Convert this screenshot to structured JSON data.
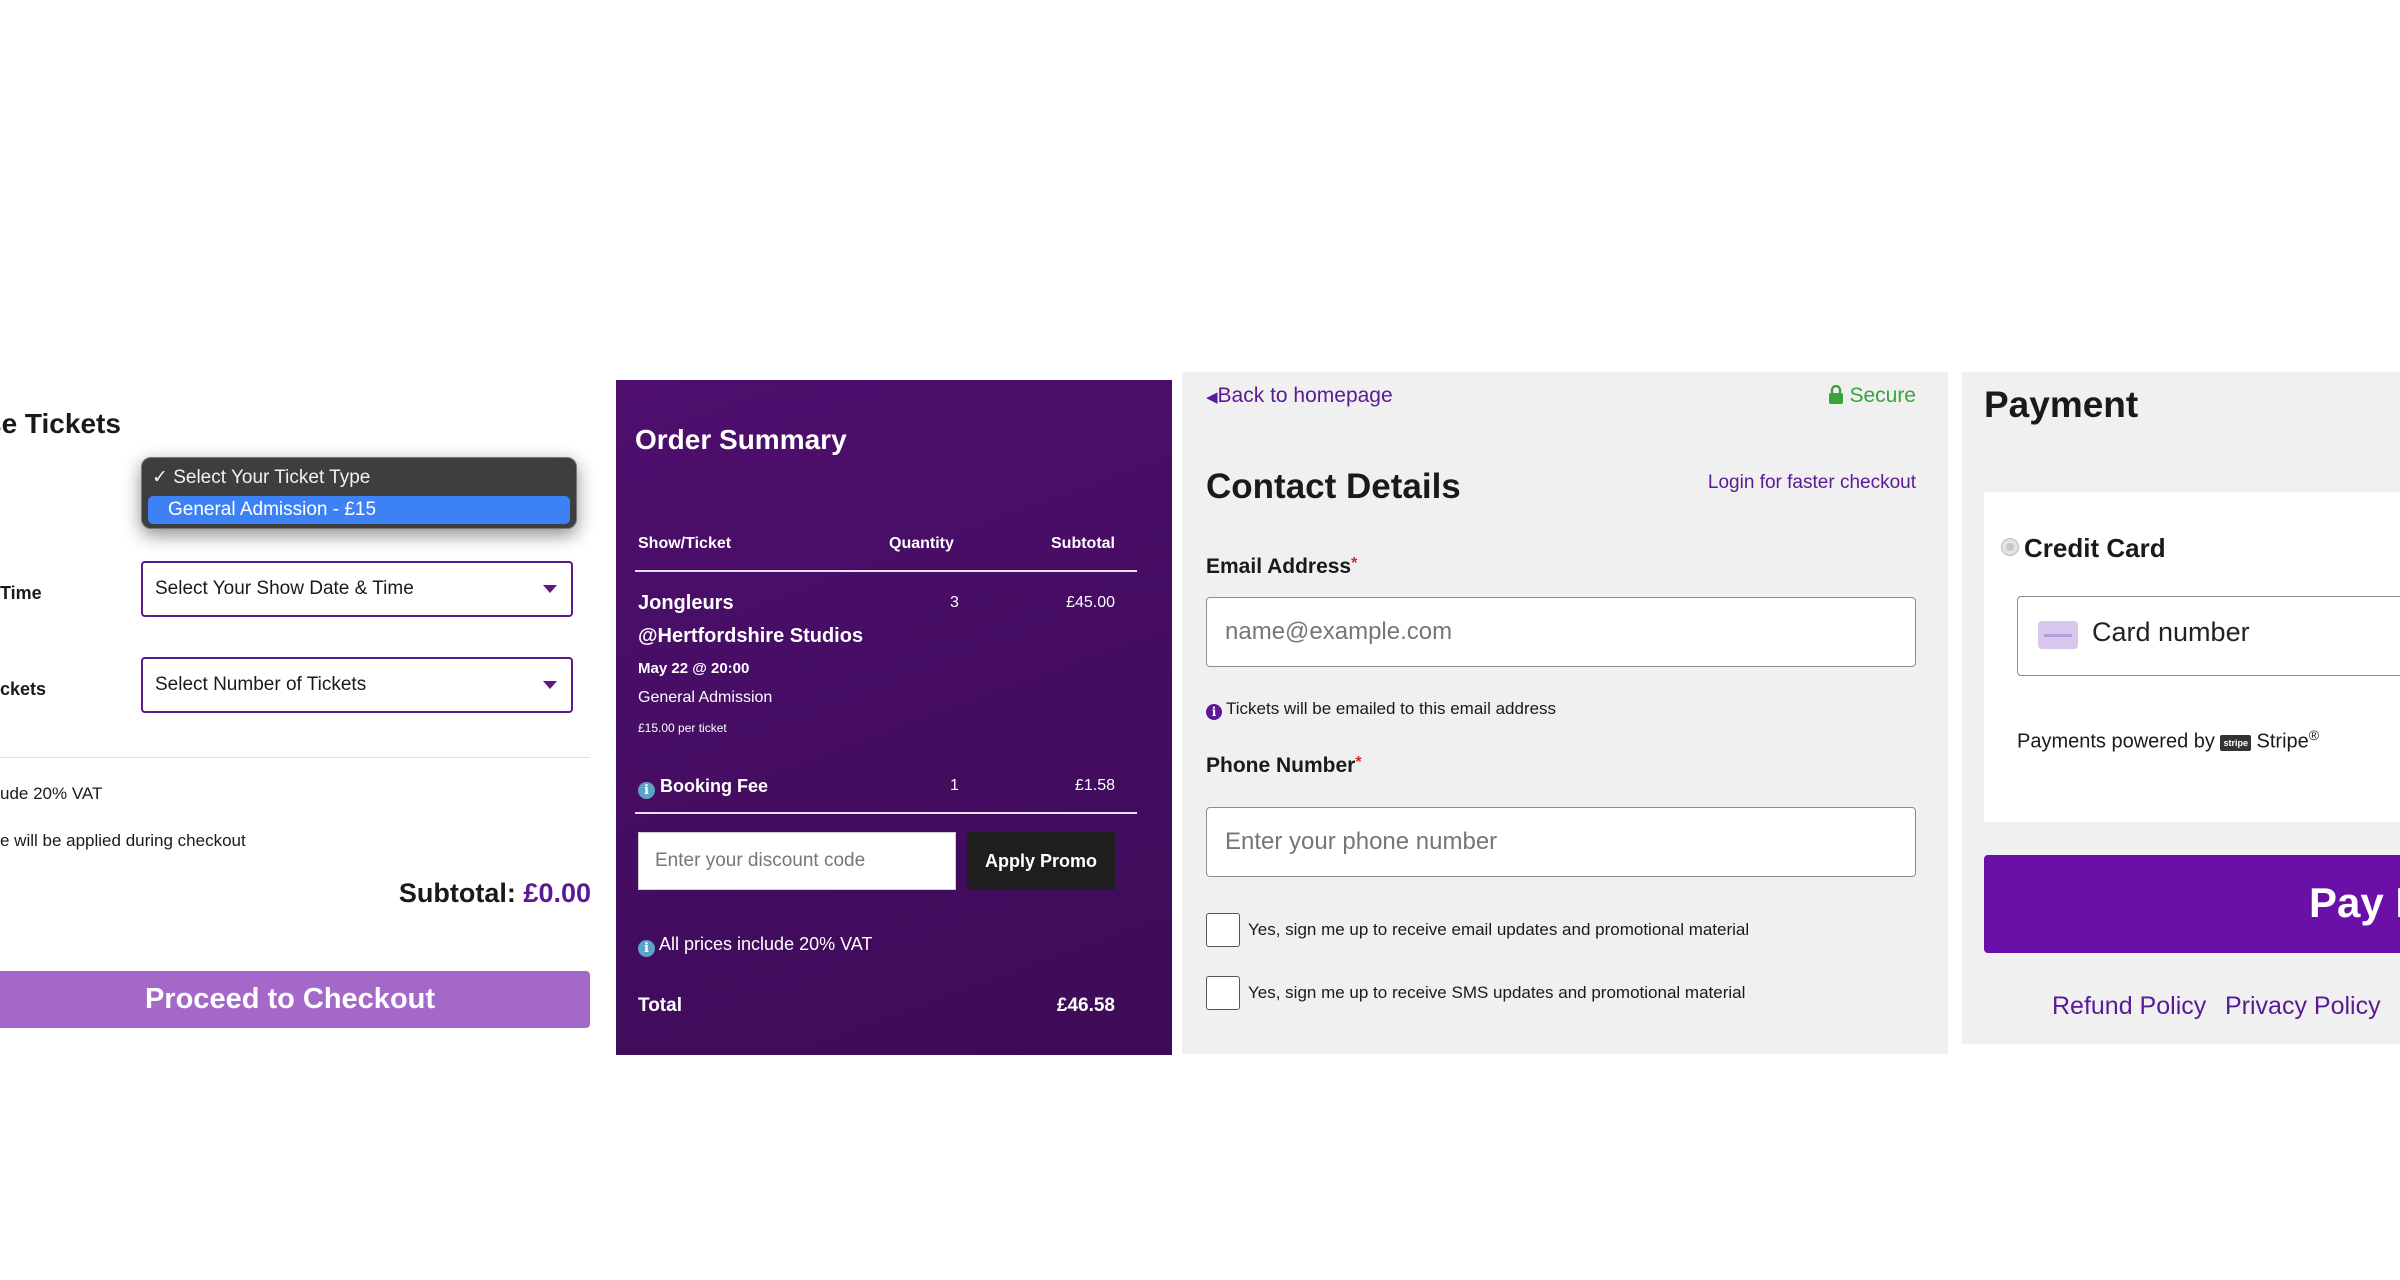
{
  "ticket_panel": {
    "title": "se Tickets",
    "ticket_type_options": [
      "Select Your Ticket Type",
      "General Admission - £15"
    ],
    "date_label": "Time",
    "date_select": "Select Your Show Date & Time",
    "tickets_label": "ckets",
    "tickets_select": "Select Number of Tickets",
    "vat_note": "ude 20% VAT",
    "fee_note": "e will be applied during checkout",
    "subtotal_label": "Subtotal:",
    "subtotal_value": "£0.00",
    "checkout_button": "Proceed to Checkout"
  },
  "order_summary": {
    "title": "Order Summary",
    "headers": {
      "show": "Show/Ticket",
      "quantity": "Quantity",
      "subtotal": "Subtotal"
    },
    "item": {
      "name_line1": "Jongleurs",
      "name_line2": "@Hertfordshire Studios",
      "date": "May 22 @ 20:00",
      "type": "General Admission",
      "unit_price": "£15.00 per ticket",
      "quantity": "3",
      "subtotal": "£45.00"
    },
    "booking_fee": {
      "label": "Booking Fee",
      "quantity": "1",
      "subtotal": "£1.58"
    },
    "discount_placeholder": "Enter your discount code",
    "promo_button": "Apply Promo",
    "vat_note": "All prices include 20% VAT",
    "total_label": "Total",
    "total_value": "£46.58"
  },
  "contact": {
    "back_link": "Back to homepage",
    "secure_label": "Secure",
    "title": "Contact Details",
    "login_link": "Login for faster checkout",
    "email_label": "Email Address",
    "email_placeholder": "name@example.com",
    "email_hint": "Tickets will be emailed to this email address",
    "phone_label": "Phone Number",
    "phone_placeholder": "Enter your phone number",
    "required_mark": "*",
    "email_optin": "Yes, sign me up to receive email updates and promotional material",
    "sms_optin": "Yes, sign me up to receive SMS updates and promotional material"
  },
  "payment": {
    "title": "Payment",
    "method_label": "Credit Card",
    "card_placeholder": "Card number",
    "powered_by": "Payments powered by",
    "stripe_badge": "stripe",
    "stripe_name": "Stripe",
    "stripe_reg": "®",
    "pay_button": "Pay N",
    "refund_link": "Refund Policy",
    "privacy_link": "Privacy Policy"
  },
  "colors": {
    "brand_purple": "#5a1a96",
    "summary_bg": "#4a0e68",
    "secure_green": "#3aa33a",
    "select_highlight": "#3d82f5"
  }
}
